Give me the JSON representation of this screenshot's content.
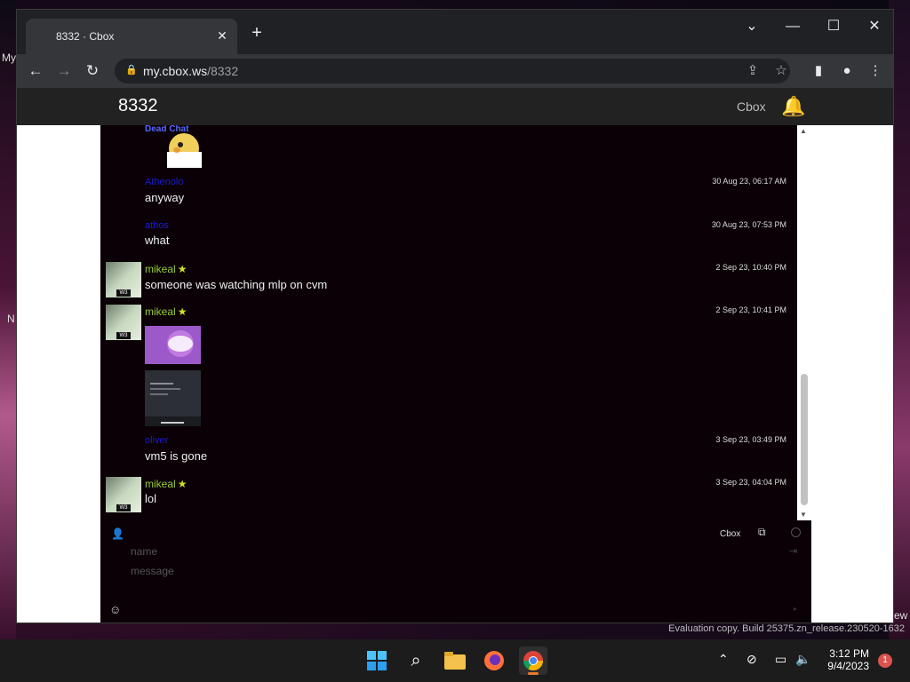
{
  "desktop": {
    "left_label_top": "My",
    "left_label_mid": "N",
    "right_label": "ew",
    "watermark": "Evaluation copy. Build 25375.zn_release.230520-1632"
  },
  "browser": {
    "tab_title": "8332 · Cbox",
    "url_host": "my.cbox.ws",
    "url_path": "/8332"
  },
  "site": {
    "title": "8332",
    "brand": "Cbox"
  },
  "messages": [
    {
      "name": "",
      "time": "",
      "text": "",
      "image_label": "Dead Chat"
    },
    {
      "name": "Athenolo",
      "time": "30 Aug 23, 06:17 AM",
      "text": "anyway"
    },
    {
      "name": "athos",
      "time": "30 Aug 23, 07:53 PM",
      "text": "what"
    },
    {
      "name": "mikeal",
      "time": "2 Sep 23, 10:40 PM",
      "text": "someone was watching mlp on cvm"
    },
    {
      "name": "mikeal",
      "time": "2 Sep 23, 10:41 PM",
      "text": ""
    },
    {
      "name": "oliver",
      "time": "3 Sep 23, 03:49 PM",
      "text": "vm5 is gone"
    },
    {
      "name": "mikeal",
      "time": "3 Sep 23, 04:04 PM",
      "text": "lol"
    }
  ],
  "form": {
    "name_placeholder": "name",
    "message_placeholder": "message",
    "cbox_link": "Cbox"
  },
  "taskbar": {
    "time": "3:12 PM",
    "date": "9/4/2023",
    "notification_count": "1"
  },
  "colors": {
    "chat_bg": "#0a0006",
    "registered_name": "#9acd32",
    "anon_name": "#1b1bd8",
    "header_bg": "#222222"
  }
}
